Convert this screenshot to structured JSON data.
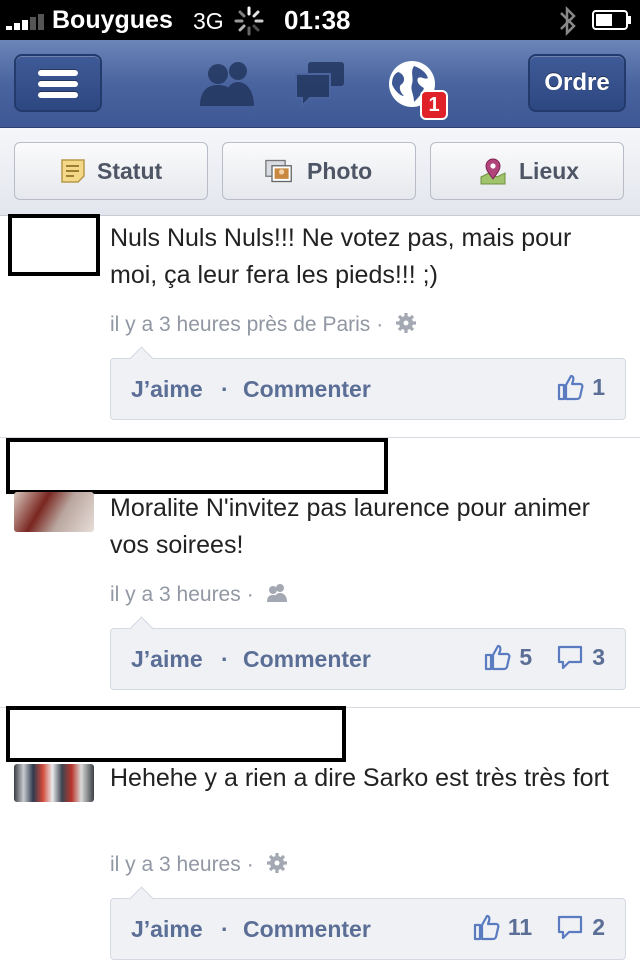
{
  "status_bar": {
    "carrier": "Bouygues",
    "network": "3G",
    "time": "01:38"
  },
  "nav": {
    "ordre_label": "Ordre",
    "notification_count": "1"
  },
  "composer": {
    "status_label": "Statut",
    "photo_label": "Photo",
    "places_label": "Lieux"
  },
  "posts": [
    {
      "text": "Nuls Nuls Nuls!!! Ne votez pas, mais pour moi, ça leur fera les pieds!!! ;)",
      "meta": "il y a 3 heures près de Paris",
      "privacy_icon": "gear-icon",
      "like_label": "J’aime",
      "comment_label": "Commenter",
      "likes": "1",
      "comments": null
    },
    {
      "text": "Moralite N'invitez pas laurence pour animer vos soirees!",
      "meta": "il y a 3 heures",
      "privacy_icon": "friends-icon",
      "like_label": "J’aime",
      "comment_label": "Commenter",
      "likes": "5",
      "comments": "3"
    },
    {
      "text": "Hehehe y a rien a dire Sarko est très très fort",
      "meta": "il y a 3 heures",
      "privacy_icon": "gear-icon",
      "like_label": "J’aime",
      "comment_label": "Commenter",
      "likes": "11",
      "comments": "2"
    }
  ],
  "colors": {
    "nav_blue": "#3d5894",
    "link_blue": "#5b6e96",
    "badge_red": "#e0212a",
    "meta_gray": "#9197a3"
  }
}
